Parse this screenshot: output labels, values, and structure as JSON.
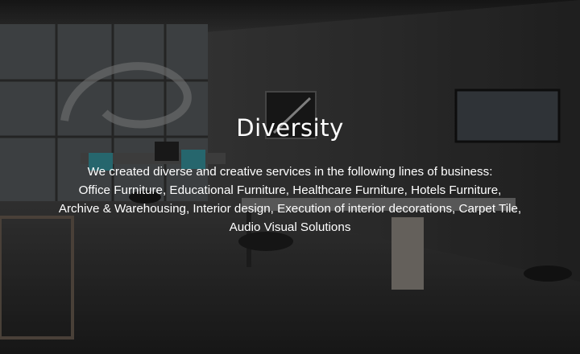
{
  "hero": {
    "title": "Diversity",
    "lines": [
      "We created diverse and creative services in the following lines of business:",
      "Office Furniture, Educational Furniture, Healthcare Furniture, Hotels Furniture,",
      "Archive & Warehousing, Interior design, Execution of interior decorations, Carpet Tile,",
      "Audio Visual Solutions"
    ]
  },
  "colors": {
    "text": "#ffffff",
    "background": "#2a2a2a"
  }
}
